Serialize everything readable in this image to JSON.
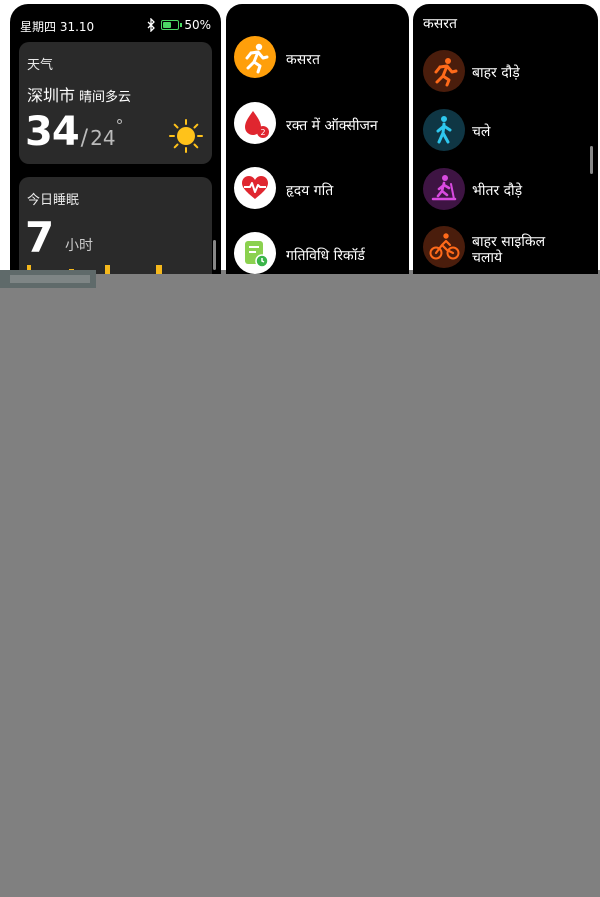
{
  "colors": {
    "background": "#808080",
    "screen": "#000000",
    "card": "#2a2a2a",
    "battery_green": "#4cd964",
    "sun_yellow": "#ffc21a",
    "sleep_bars": [
      "#f5b81c",
      "#3d9df2",
      "#3d9df2"
    ]
  },
  "watch_face": {
    "status_bar": {
      "date": "星期四 31.10",
      "bluetooth_icon": "bluetooth-icon",
      "battery_percent_label": "50%",
      "battery_level": 0.5
    },
    "weather": {
      "title": "天气",
      "city": "深圳市",
      "condition": "晴间多云",
      "temp_now": "34",
      "temp_low": "24",
      "degree": "°",
      "icon": "sun-icon"
    },
    "sleep": {
      "title": "今日睡眠",
      "hours": "7",
      "unit": "小时"
    }
  },
  "app_menu": {
    "items": [
      {
        "label": "कसरत",
        "icon": "running-icon",
        "color": "#ff9f0a"
      },
      {
        "label": "रक्त में ऑक्सीजन",
        "icon": "blood-oxygen-icon",
        "color": "#ffffff"
      },
      {
        "label": "हृदय गति",
        "icon": "heart-rate-icon",
        "color": "#ffffff"
      },
      {
        "label": "गतिविधि रिकॉर्ड",
        "icon": "activity-record-icon",
        "color": "#ffffff"
      }
    ]
  },
  "workout_list": {
    "title": "कसरत",
    "items": [
      {
        "label": "बाहर दौड़े",
        "icon": "outdoor-run-icon",
        "color": "#ff6a1a"
      },
      {
        "label": "चले",
        "icon": "walk-icon",
        "color": "#2ec7ee"
      },
      {
        "label": "भीतर दौड़े",
        "icon": "treadmill-icon",
        "color": "#d84adf"
      },
      {
        "label": "बाहर साइकिल\nचलाये",
        "icon": "outdoor-cycle-icon",
        "color": "#ff6a1a"
      }
    ]
  }
}
